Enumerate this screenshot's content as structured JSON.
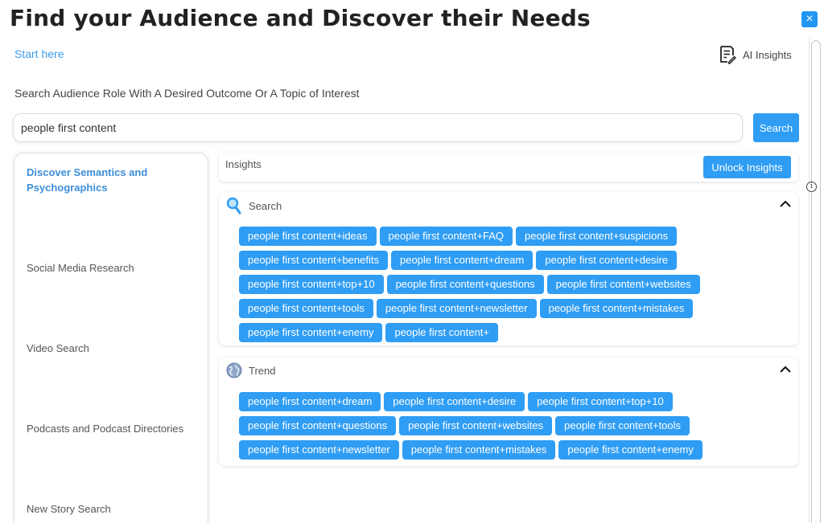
{
  "header": {
    "title": "Find your Audience and Discover their Needs",
    "close_label": "×"
  },
  "start_link": "Start here",
  "ai_insights_label": "AI Insights",
  "search": {
    "caption": "Search Audience Role With A Desired Outcome Or A Topic of Interest",
    "value": "people first content",
    "button_label": "Search"
  },
  "sidebar": {
    "items": [
      {
        "label": "Discover Semantics and Psychographics"
      },
      {
        "label": "Social Media Research"
      },
      {
        "label": "Video Search"
      },
      {
        "label": "Podcasts and Podcast Directories"
      },
      {
        "label": "New Story Search"
      }
    ]
  },
  "insights": {
    "label": "Insights",
    "unlock_label": "Unlock Insights",
    "info_glyph": "i"
  },
  "search_section": {
    "title": "Search",
    "icon": "magnifier-icon",
    "chips": [
      "people first content+ideas",
      "people first content+FAQ",
      "people first content+suspicions",
      "people first content+benefits",
      "people first content+dream",
      "people first content+desire",
      "people first content+top+10",
      "people first content+questions",
      "people first content+websites",
      "people first content+tools",
      "people first content+newsletter",
      "people first content+mistakes",
      "people first content+enemy",
      "people first content+"
    ]
  },
  "trend_section": {
    "title": "Trend",
    "icon": "globe-icon",
    "chips": [
      "people first content+dream",
      "people first content+desire",
      "people first content+top+10",
      "people first content+questions",
      "people first content+websites",
      "people first content+tools",
      "people first content+newsletter",
      "people first content+mistakes",
      "people first content+enemy"
    ]
  },
  "colors": {
    "accent": "#2f9df4",
    "link": "#3d9be9",
    "active_nav": "#3d8ed8"
  }
}
